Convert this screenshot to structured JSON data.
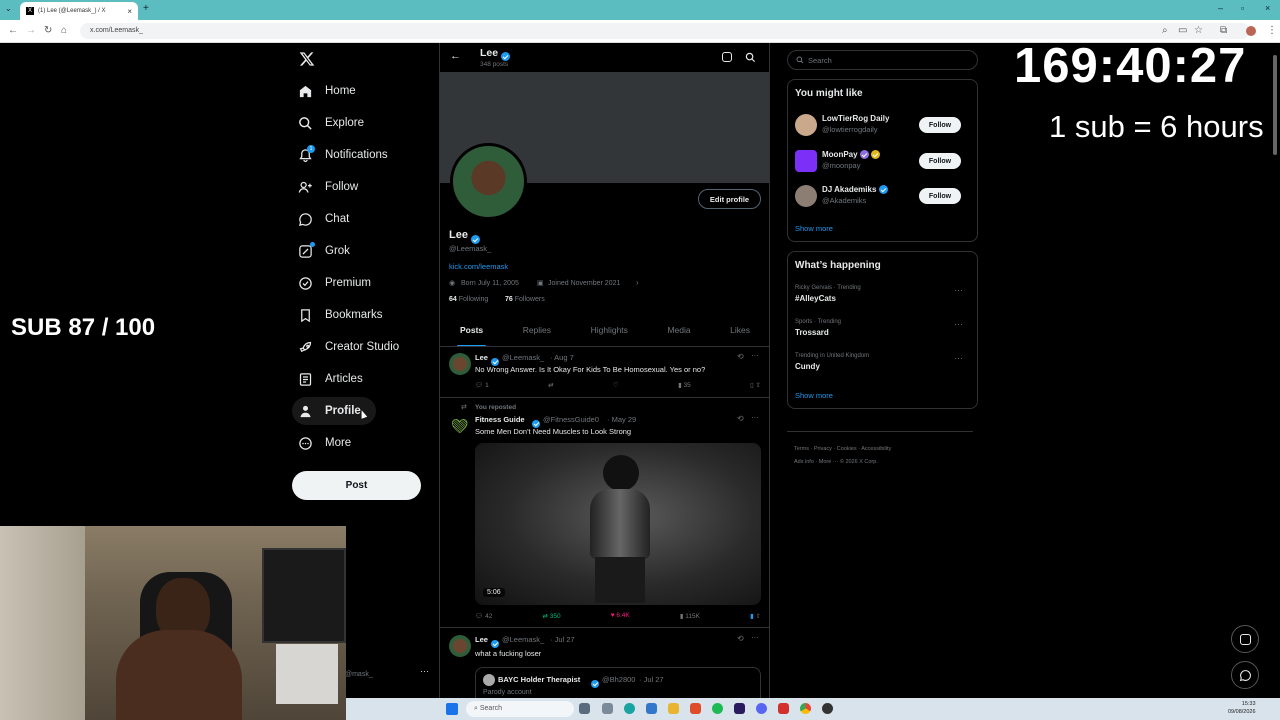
{
  "browser": {
    "tab_title": "(1) Lee (@Leemask_) / X",
    "url": "x.com/Leemask_"
  },
  "sidebar": {
    "items": [
      {
        "label": "Home"
      },
      {
        "label": "Explore"
      },
      {
        "label": "Notifications"
      },
      {
        "label": "Follow"
      },
      {
        "label": "Chat"
      },
      {
        "label": "Grok"
      },
      {
        "label": "Premium"
      },
      {
        "label": "Bookmarks"
      },
      {
        "label": "Creator Studio"
      },
      {
        "label": "Articles"
      },
      {
        "label": "Profile"
      },
      {
        "label": "More"
      }
    ],
    "notif_badge": "1",
    "post_label": "Post",
    "account_handle": "@mask_"
  },
  "profile": {
    "header_name": "Lee",
    "post_count": "348 posts",
    "edit_label": "Edit profile",
    "name": "Lee",
    "handle": "@Leemask_",
    "link": "kick.com/leemask",
    "born": "Born July 11, 2005",
    "joined": "Joined November 2021",
    "following_count": "64",
    "following_label": "Following",
    "followers_count": "76",
    "followers_label": "Followers",
    "tabs": [
      "Posts",
      "Replies",
      "Highlights",
      "Media",
      "Likes"
    ]
  },
  "feed": {
    "post1": {
      "name": "Lee",
      "handle": "@Leemask_",
      "date": "· Aug 7",
      "text": "No Wrong Answer. Is It Okay For Kids To Be Homosexual. Yes or no?",
      "replies": "1",
      "views": "35"
    },
    "post2": {
      "repost_label": "You reposted",
      "name": "Fitness Guide",
      "handle": "@FitnessGuide0",
      "date": "· May 29",
      "text": "Some Men Don't Need Muscles to Look Strong",
      "duration": "5:06",
      "replies": "42",
      "reposts": "350",
      "likes": "6.4K",
      "views": "115K"
    },
    "post3": {
      "name": "Lee",
      "handle": "@Leemask_",
      "date": "· Jul 27",
      "text": "what a fucking loser",
      "quote_name": "BAYC Holder Therapist",
      "quote_handle": "@Bh2800",
      "quote_date": "· Jul 27",
      "quote_sub": "Parody account"
    }
  },
  "right": {
    "search_placeholder": "Search",
    "suggest_title": "You might like",
    "follow_label": "Follow",
    "suggestions": [
      {
        "name": "LowTierRog Daily",
        "handle": "@lowtierrogdaily"
      },
      {
        "name": "MoonPay",
        "handle": "@moonpay"
      },
      {
        "name": "DJ Akademiks",
        "handle": "@Akademiks"
      }
    ],
    "show_more": "Show more",
    "happening_title": "What’s happening",
    "trends": [
      {
        "context": "Ricky Gervais · Trending",
        "topic": "#AlleyCats"
      },
      {
        "context": "Sports · Trending",
        "topic": "Trossard"
      },
      {
        "context": "Trending in United Kingdom",
        "topic": "Cundy"
      }
    ],
    "footer": {
      "terms": "Terms",
      "privacy": "Privacy",
      "cookies": "Cookies",
      "accessibility": "Accessibility",
      "ads": "Ads info",
      "more": "More ···",
      "copyright": "© 2026 X Corp."
    }
  },
  "overlay": {
    "timer": "169:40:27",
    "sub_rule": "1 sub = 6 hours",
    "sub_goal": "SUB 87 / 100"
  },
  "taskbar": {
    "search": "Search",
    "time": "15:33",
    "date": "09/08/2026"
  },
  "colors": {
    "accent": "#1d9bf0",
    "like": "#f91880",
    "repost": "#00ba7c",
    "browser_frame": "#5bbdbf"
  }
}
